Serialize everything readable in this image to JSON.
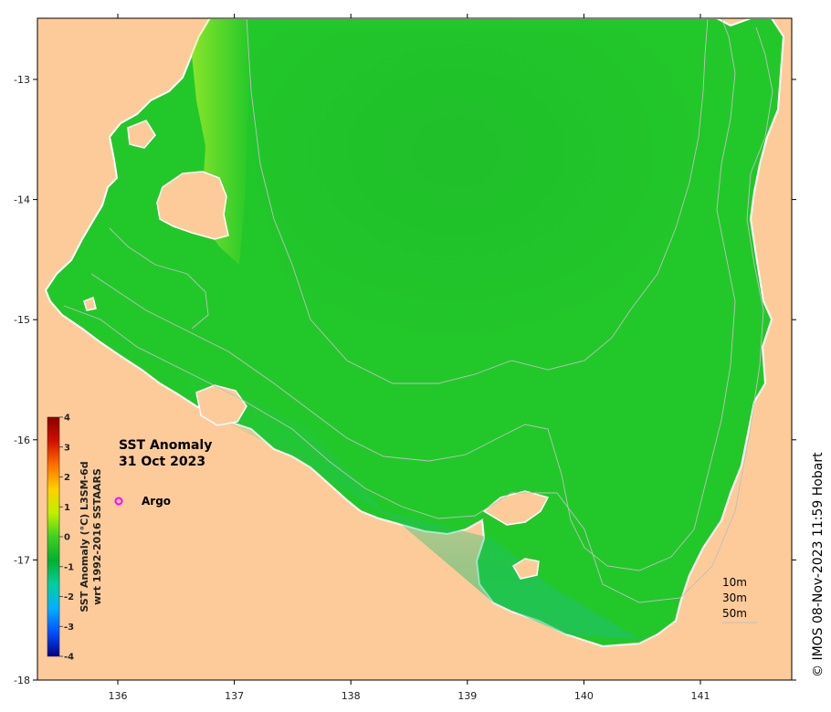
{
  "map": {
    "title_line1": "SST Anomaly",
    "title_line2": "31 Oct 2023",
    "x_ticks": [
      "136",
      "137",
      "138",
      "139",
      "140",
      "141"
    ],
    "y_ticks": [
      "-13",
      "-14",
      "-15",
      "-16",
      "-17",
      "-18"
    ],
    "colorbar": {
      "ticks": [
        "4",
        "3",
        "2",
        "1",
        "0",
        "-1",
        "-2",
        "-3",
        "-4"
      ],
      "label_line1": "SST Anomaly (°C) L3SM-6d",
      "label_line2": "wrt 1992-2016 SSTAARS",
      "colors": [
        "#00008b",
        "#0050ff",
        "#00b0ff",
        "#00d0a0",
        "#00b030",
        "#40d020",
        "#c0f000",
        "#ffd000",
        "#ff7000",
        "#d01000",
        "#8b0000"
      ]
    },
    "legend": {
      "argo_label": "Argo",
      "argo_color": "#ff00ff"
    },
    "depth_labels": [
      "10m",
      "30m",
      "50m"
    ],
    "credit": "© IMOS 08-Nov-2023 11:59 Hobart",
    "colors": {
      "land": "#fdcb9a",
      "sea": "#22c82a",
      "sea_dark": "#1cb22a",
      "sea_light": "#9ee82a",
      "contour": "#bfbfbf"
    }
  }
}
